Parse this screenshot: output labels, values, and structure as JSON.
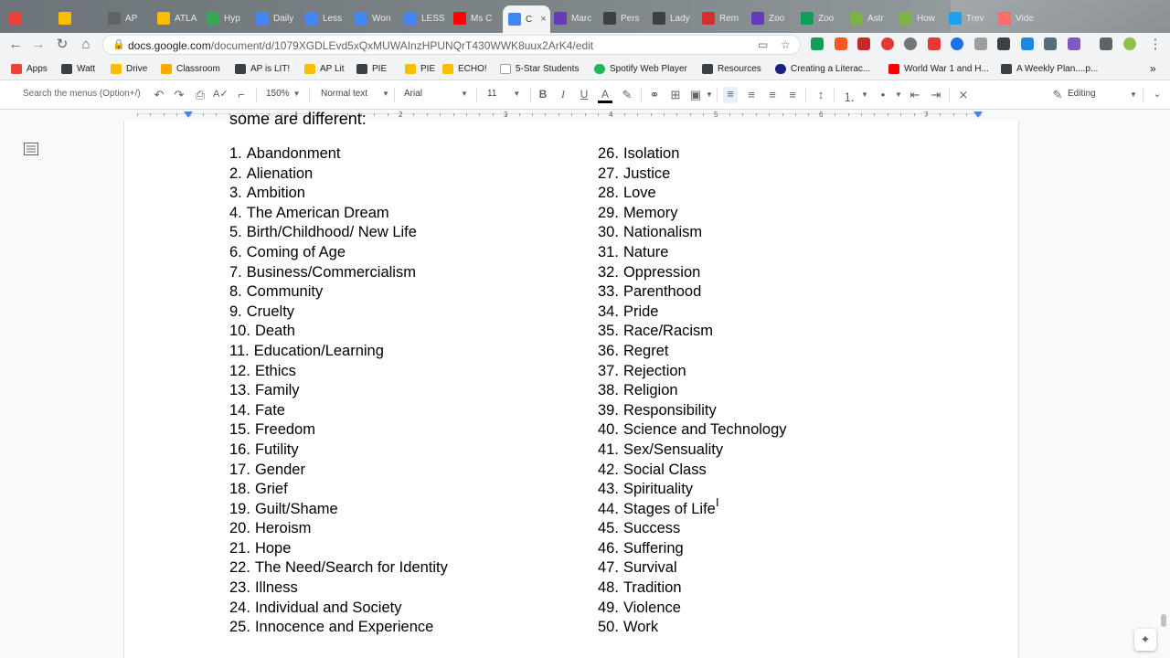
{
  "browser": {
    "tabs": [
      {
        "label": "",
        "color": "#ea4335"
      },
      {
        "label": "",
        "color": "#fbbc04"
      },
      {
        "label": "AP",
        "color": "#5f6368"
      },
      {
        "label": "ATLA",
        "color": "#fbbc04"
      },
      {
        "label": "Hyp",
        "color": "#34a853"
      },
      {
        "label": "Daily",
        "color": "#4285f4"
      },
      {
        "label": "Less",
        "color": "#4285f4"
      },
      {
        "label": "Won",
        "color": "#4285f4"
      },
      {
        "label": "LESS",
        "color": "#4285f4"
      },
      {
        "label": "Ms C",
        "color": "#ff0000"
      },
      {
        "label": "C",
        "color": "#4285f4",
        "active": true
      },
      {
        "label": "Marc",
        "color": "#673ab7"
      },
      {
        "label": "Pers",
        "color": "#3c4043"
      },
      {
        "label": "Lady",
        "color": "#3c4043"
      },
      {
        "label": "Rem",
        "color": "#d32f2f"
      },
      {
        "label": "Zoo",
        "color": "#673ab7"
      },
      {
        "label": "Zoo",
        "color": "#0f9d58"
      },
      {
        "label": "Astr",
        "color": "#7cb342"
      },
      {
        "label": "How",
        "color": "#7cb342"
      },
      {
        "label": "Trev",
        "color": "#1da1f2"
      },
      {
        "label": "Vide",
        "color": "#ff6d6d"
      }
    ],
    "address": {
      "url_host": "docs.google.com",
      "url_path": "/document/d/1079XGDLEvd5xQxMUWAInzHPUNQrT430WWK8uux2ArK4/edit"
    },
    "bookmarks": [
      {
        "label": "Apps",
        "icon": "apps-grid-icon",
        "color": "#ea4335"
      },
      {
        "label": "Watt",
        "icon": "folder-icon",
        "color": "#3c4043"
      },
      {
        "label": "Drive",
        "icon": "drive-icon",
        "color": "#fbbc04"
      },
      {
        "label": "Classroom",
        "icon": "classroom-icon",
        "color": "#f9ab00"
      },
      {
        "label": "AP is LIT!",
        "icon": "folder-icon",
        "color": "#3c4043"
      },
      {
        "label": "AP Lit",
        "icon": "drive-icon",
        "color": "#fbbc04"
      },
      {
        "label": "PIE",
        "icon": "folder-icon",
        "color": "#3c4043"
      },
      {
        "label": "PIE",
        "icon": "drive-icon",
        "color": "#fbbc04"
      },
      {
        "label": "ECHO!",
        "icon": "drive-icon",
        "color": "#fbbc04"
      },
      {
        "label": "5-Star Students",
        "icon": "page-icon",
        "color": "#ffffff"
      },
      {
        "label": "Spotify Web Player",
        "icon": "spotify-icon",
        "color": "#1db954"
      },
      {
        "label": "Resources",
        "icon": "folder-icon",
        "color": "#3c4043"
      },
      {
        "label": "Creating a Literac...",
        "icon": "globe-icon",
        "color": "#1a237e"
      },
      {
        "label": "World War 1 and H...",
        "icon": "youtube-icon",
        "color": "#ff0000"
      },
      {
        "label": "A Weekly Plan....p...",
        "icon": "shield-icon",
        "color": "#3c4043"
      }
    ]
  },
  "docs_toolbar": {
    "search_placeholder": "Search the menus (Option+/)",
    "zoom": "150%",
    "style": "Normal text",
    "font": "Arial",
    "font_size": "11",
    "mode": "Editing"
  },
  "ruler": {
    "numbers": [
      "1",
      "2",
      "3",
      "4",
      "5",
      "6",
      "7"
    ]
  },
  "document": {
    "cutoff_text": "some are different:",
    "themes_left": [
      {
        "num": "1.",
        "text": "Abandonment"
      },
      {
        "num": "2.",
        "text": "Alienation"
      },
      {
        "num": "3.",
        "text": "Ambition"
      },
      {
        "num": "4.",
        "text": "The American Dream"
      },
      {
        "num": "5.",
        "text": "Birth/Childhood/ New Life"
      },
      {
        "num": "6.",
        "text": "Coming of Age"
      },
      {
        "num": "7.",
        "text": "Business/Commercialism"
      },
      {
        "num": "8.",
        "text": "Community"
      },
      {
        "num": "9.",
        "text": "Cruelty"
      },
      {
        "num": "10.",
        "text": "Death"
      },
      {
        "num": "11.",
        "text": "Education/Learning"
      },
      {
        "num": "12.",
        "text": "Ethics"
      },
      {
        "num": "13.",
        "text": "Family"
      },
      {
        "num": "14.",
        "text": "Fate"
      },
      {
        "num": "15.",
        "text": "Freedom"
      },
      {
        "num": "16.",
        "text": "Futility"
      },
      {
        "num": "17.",
        "text": "Gender"
      },
      {
        "num": "18.",
        "text": "Grief"
      },
      {
        "num": "19.",
        "text": "Guilt/Shame"
      },
      {
        "num": "20.",
        "text": "Heroism"
      },
      {
        "num": "21.",
        "text": "Hope"
      },
      {
        "num": "22.",
        "text": "The Need/Search for Identity"
      },
      {
        "num": "23.",
        "text": "Illness"
      },
      {
        "num": "24.",
        "text": "Individual and Society"
      },
      {
        "num": "25.",
        "text": "Innocence and Experience"
      }
    ],
    "themes_right": [
      {
        "num": "26.",
        "text": "Isolation"
      },
      {
        "num": "27.",
        "text": "Justice"
      },
      {
        "num": "28.",
        "text": "Love"
      },
      {
        "num": "29.",
        "text": "Memory"
      },
      {
        "num": "30.",
        "text": "Nationalism"
      },
      {
        "num": "31.",
        "text": "Nature"
      },
      {
        "num": "32.",
        "text": "Oppression"
      },
      {
        "num": "33.",
        "text": "Parenthood"
      },
      {
        "num": "34.",
        "text": "Pride"
      },
      {
        "num": "35.",
        "text": "Race/Racism"
      },
      {
        "num": "36.",
        "text": "Regret"
      },
      {
        "num": "37.",
        "text": "Rejection"
      },
      {
        "num": "38.",
        "text": "Religion"
      },
      {
        "num": "39.",
        "text": "Responsibility"
      },
      {
        "num": "40.",
        "text": "Science and Technology"
      },
      {
        "num": "41.",
        "text": "Sex/Sensuality"
      },
      {
        "num": "42.",
        "text": "Social Class"
      },
      {
        "num": "43.",
        "text": "Spirituality"
      },
      {
        "num": "44.",
        "text": "Stages of Life"
      },
      {
        "num": "45.",
        "text": "Success"
      },
      {
        "num": "46.",
        "text": "Suffering"
      },
      {
        "num": "47.",
        "text": "Survival"
      },
      {
        "num": "48.",
        "text": "Tradition"
      },
      {
        "num": "49.",
        "text": "Violence"
      },
      {
        "num": "50.",
        "text": "Work"
      }
    ]
  }
}
